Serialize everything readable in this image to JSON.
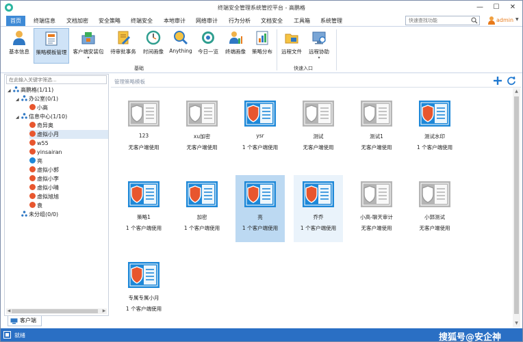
{
  "window": {
    "title": "终端安全管理系统管控平台 - 高鹏格",
    "min": "—",
    "max": "☐",
    "close": "✕"
  },
  "menu": {
    "items": [
      "首页",
      "终端信息",
      "文档加密",
      "安全策略",
      "终端安全",
      "本地审计",
      "网络审计",
      "行为分析",
      "文档安全",
      "工具箱",
      "系统管理"
    ],
    "active_index": 0,
    "search_placeholder": "快速查找功能",
    "user": "admin"
  },
  "ribbon": {
    "buttons": [
      {
        "label": "基本信息",
        "icon": "person-icon"
      },
      {
        "label": "策略模板管理",
        "icon": "template-icon",
        "active": true
      },
      {
        "label": "客户端安装包",
        "icon": "installer-icon",
        "dropdown": "▾"
      },
      {
        "label": "待审批事务",
        "icon": "approval-icon"
      },
      {
        "label": "时间画像",
        "icon": "clock-icon"
      },
      {
        "label": "Anything",
        "icon": "magnifier-icon"
      },
      {
        "label": "今日一览",
        "icon": "target-icon"
      },
      {
        "label": "终端画像",
        "icon": "user-chart-icon"
      },
      {
        "label": "策略分布",
        "icon": "chart-icon"
      },
      {
        "label": "远程文件",
        "icon": "folder-icon"
      },
      {
        "label": "远程协助",
        "icon": "monitor-icon",
        "dropdown": "▾"
      }
    ],
    "groups": [
      "基础",
      "快速入口"
    ]
  },
  "tree": {
    "filter_placeholder": "在此输入关键字筛选...",
    "nodes": [
      {
        "label": "高鹏格(1/11)",
        "toggle": "◢",
        "kind": "org"
      },
      {
        "label": "办公室(0/1)",
        "toggle": "◢",
        "kind": "org"
      },
      {
        "label": "小高",
        "kind": "off"
      },
      {
        "label": "信息中心(1/10)",
        "toggle": "◢",
        "kind": "org"
      },
      {
        "label": "奇异奥",
        "kind": "off"
      },
      {
        "label": "虚拟小月",
        "kind": "off",
        "selected": true
      },
      {
        "label": "w55",
        "kind": "off"
      },
      {
        "label": "yinsairan",
        "kind": "off"
      },
      {
        "label": "亮",
        "kind": "on"
      },
      {
        "label": "虚拟小郭",
        "kind": "off"
      },
      {
        "label": "虚拟小李",
        "kind": "off"
      },
      {
        "label": "虚拟小晴",
        "kind": "off"
      },
      {
        "label": "虚拟旭旭",
        "kind": "off"
      },
      {
        "label": "袁",
        "kind": "off"
      },
      {
        "label": "未分组(0/0)",
        "kind": "org"
      }
    ],
    "scroll_left": "◀",
    "scroll_right": "▶"
  },
  "client_tab": "客户端",
  "panel": {
    "title": "管理策略模板",
    "add": "add-icon",
    "refresh": "refresh-icon",
    "scroll_up": "▲",
    "scroll_down": "▼"
  },
  "templates": [
    {
      "name": "123",
      "count": "无客户端使用",
      "active": false
    },
    {
      "name": "xu加密",
      "count": "无客户端使用",
      "active": false
    },
    {
      "name": "ysr",
      "count": "1 个客户端使用",
      "active": true
    },
    {
      "name": "测试",
      "count": "无客户端使用",
      "active": false
    },
    {
      "name": "测试1",
      "count": "无客户端使用",
      "active": false
    },
    {
      "name": "测试水印",
      "count": "1 个客户端使用",
      "active": true
    },
    {
      "name": "策略1",
      "count": "1 个客户端使用",
      "active": true
    },
    {
      "name": "加密",
      "count": "1 个客户端使用",
      "active": true
    },
    {
      "name": "亮",
      "count": "1 个客户端使用",
      "active": true,
      "selected": true
    },
    {
      "name": "乔乔",
      "count": "1 个客户端使用",
      "active": true,
      "hover": true
    },
    {
      "name": "小高-聊天审计",
      "count": "无客户端使用",
      "active": false
    },
    {
      "name": "小郭测试",
      "count": "无客户端使用",
      "active": false
    },
    {
      "name": "专属专属小月",
      "count": "1 个客户端使用",
      "active": true
    }
  ],
  "status": {
    "text": "就绪",
    "watermark": "搜狐号@安企神"
  },
  "colors": {
    "accent": "#3e8ad6",
    "status_bar": "#2a6fc4",
    "active_tile": "#1e88d8",
    "shield": "#e8562e",
    "inactive_tile": "#b5b5b5"
  }
}
